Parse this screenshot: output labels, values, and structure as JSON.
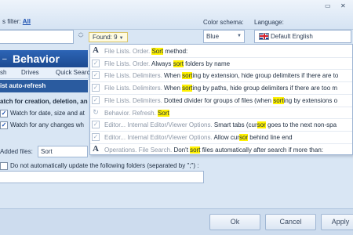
{
  "filter": {
    "label": "s filter:",
    "value": "All"
  },
  "found": {
    "label": "Found: 9"
  },
  "schema": {
    "label": "Color schema:",
    "value": "Blue"
  },
  "language": {
    "label": "Language:",
    "value": "Default English"
  },
  "section": {
    "title": "Behavior",
    "tabs": [
      "sh",
      "Drives",
      "Quick Searc"
    ],
    "bar": "ist auto-refresh",
    "watch_heading": "atch for creation, deletion, an",
    "watch_date": "Watch for date, size and at",
    "watch_any": "Watch for any changes wh",
    "added_label": "Added files:",
    "added_value": "Sort",
    "no_update": "Do not automatically update the following folders (separated by \";\") :"
  },
  "results": [
    {
      "icon": "A",
      "path": "File Lists. Order. ",
      "pre": "",
      "hl": "Sort",
      "post": " method:"
    },
    {
      "icon": "check",
      "path": "File Lists. Order. ",
      "pre": "Always ",
      "hl": "sort",
      "post": " folders by name"
    },
    {
      "icon": "check",
      "path": "File Lists. Delimiters. ",
      "pre": "When ",
      "hl": "sort",
      "post": "ing by extension, hide group delimiters if there are to"
    },
    {
      "icon": "check",
      "path": "File Lists. Delimiters. ",
      "pre": "When ",
      "hl": "sort",
      "post": "ing by paths, hide group delimiters if there are too m"
    },
    {
      "icon": "check",
      "path": "File Lists. Delimiters. ",
      "pre": "Dotted divider for groups of files (when ",
      "hl": "sort",
      "post": "ing by extensions o"
    },
    {
      "icon": "behavior",
      "path": "Behavior. Refresh. ",
      "pre": "",
      "hl": "Sort",
      "post": ""
    },
    {
      "icon": "check",
      "path": "Editor... Internal Editor/Viewer Options. ",
      "pre": "Smart tabs (cur",
      "hl": "sor",
      "post": " goes to the next non-spa"
    },
    {
      "icon": "check",
      "path": "Editor... Internal Editor/Viewer Options. ",
      "pre": "Allow cur",
      "hl": "sor",
      "post": " behind line end"
    },
    {
      "icon": "A",
      "path": "Operations. File Search. ",
      "pre": "Don't ",
      "hl": "sort",
      "post": " files automatically after search if more than:"
    }
  ],
  "buttons": {
    "ok": "Ok",
    "cancel": "Cancel",
    "apply": "Apply"
  },
  "colors": {
    "accent": "#1c4a91",
    "highlight": "#fff100"
  }
}
